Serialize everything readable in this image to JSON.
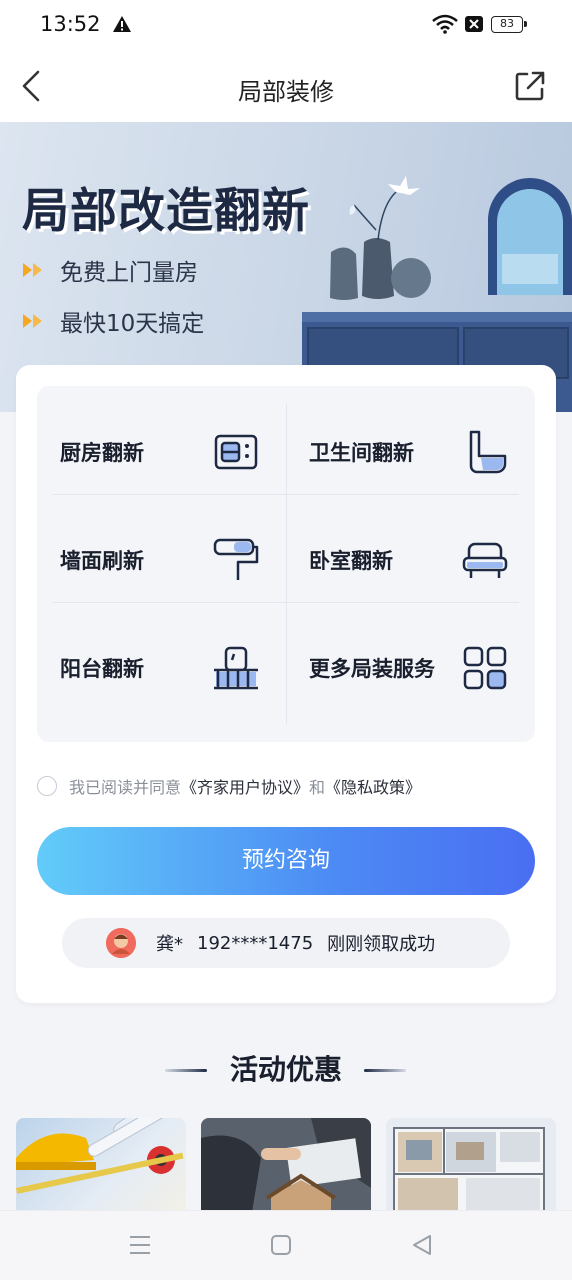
{
  "status_bar": {
    "time": "13:52",
    "battery": "83"
  },
  "nav": {
    "title": "局部装修"
  },
  "banner": {
    "title": "局部改造翻新",
    "bullets": [
      "免费上门量房",
      "最快10天搞定"
    ]
  },
  "services": [
    {
      "label": "厨房翻新",
      "icon": "kitchen-icon"
    },
    {
      "label": "卫生间翻新",
      "icon": "toilet-icon"
    },
    {
      "label": "墙面刷新",
      "icon": "paint-roller-icon"
    },
    {
      "label": "卧室翻新",
      "icon": "bed-icon"
    },
    {
      "label": "阳台翻新",
      "icon": "balcony-icon"
    },
    {
      "label": "更多局装服务",
      "icon": "grid-icon"
    }
  ],
  "agreement": {
    "prefix": "我已阅读并同意",
    "user_agreement": "《齐家用户协议》",
    "and": "和",
    "privacy_policy": "《隐私政策》"
  },
  "cta": {
    "label": "预约咨询"
  },
  "notice": {
    "name": "龚*",
    "phone": "192****1475",
    "message": "刚刚领取成功"
  },
  "section": {
    "title": "活动优惠"
  },
  "colors": {
    "cta_start": "#62ccf9",
    "cta_end": "#4a6ef2",
    "accent_orange": "#f5a623",
    "icon_blue": "#9bb8f0"
  }
}
